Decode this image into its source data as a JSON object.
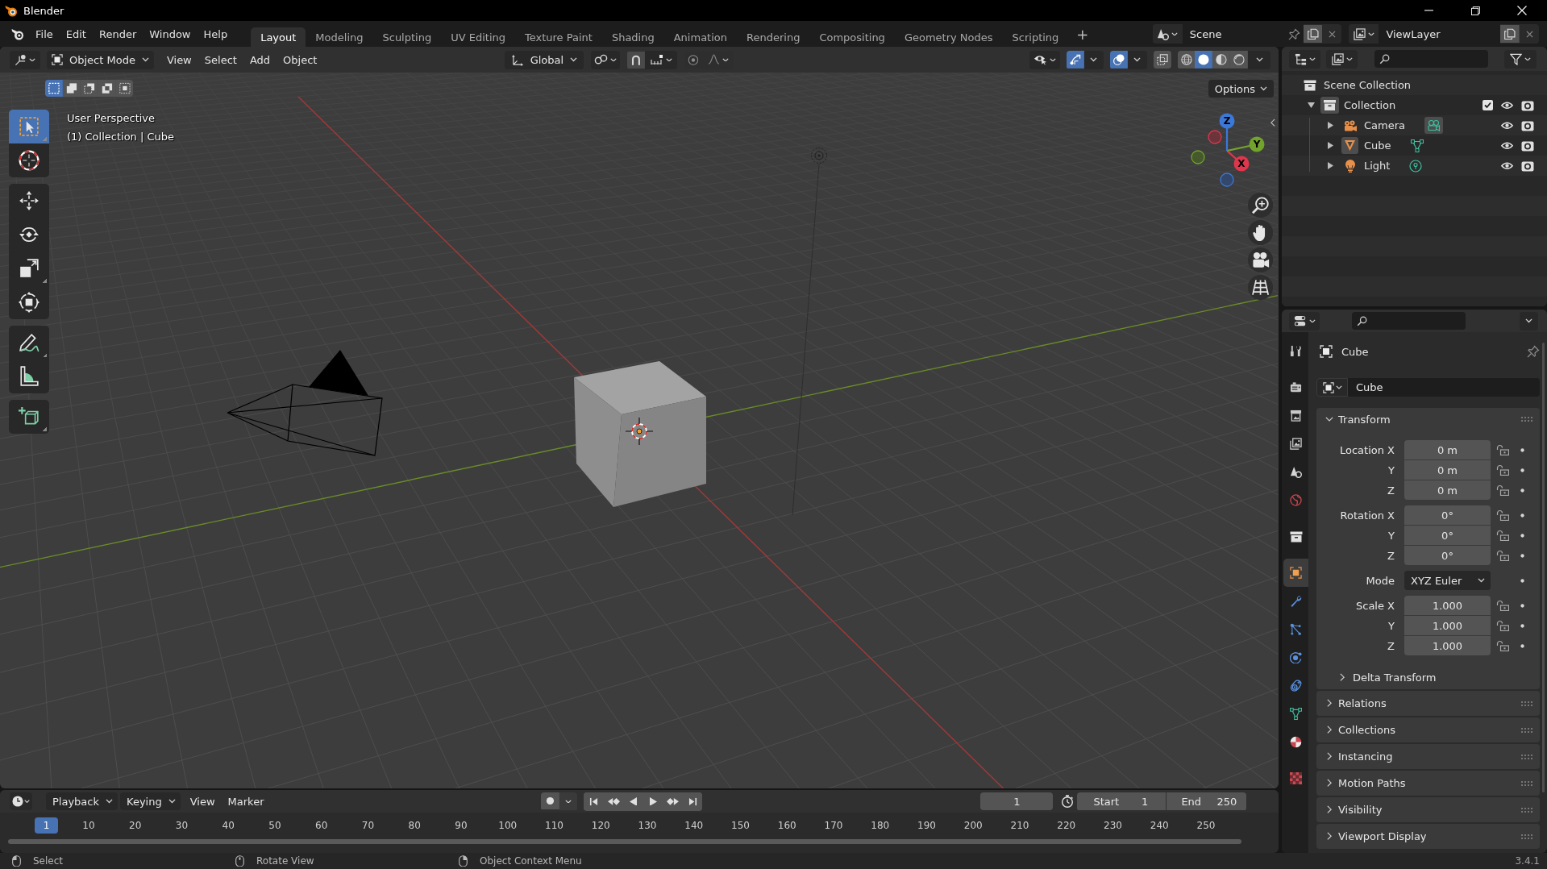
{
  "window": {
    "title": "Blender"
  },
  "top_bar": {
    "menus": [
      "File",
      "Edit",
      "Render",
      "Window",
      "Help"
    ],
    "workspaces": [
      {
        "label": "Layout",
        "selected": true
      },
      {
        "label": "Modeling",
        "selected": false
      },
      {
        "label": "Sculpting",
        "selected": false
      },
      {
        "label": "UV Editing",
        "selected": false
      },
      {
        "label": "Texture Paint",
        "selected": false
      },
      {
        "label": "Shading",
        "selected": false
      },
      {
        "label": "Animation",
        "selected": false
      },
      {
        "label": "Rendering",
        "selected": false
      },
      {
        "label": "Compositing",
        "selected": false
      },
      {
        "label": "Geometry Nodes",
        "selected": false
      },
      {
        "label": "Scripting",
        "selected": false
      }
    ],
    "add_workspace": "+",
    "scene": "Scene",
    "view_layer": "ViewLayer"
  },
  "viewport": {
    "header": {
      "mode": "Object Mode",
      "menus": [
        "View",
        "Select",
        "Add",
        "Object"
      ],
      "orientation": "Global",
      "snap": false,
      "proportional_editing": false,
      "gizmos": true,
      "overlays": true,
      "xray": false,
      "shading": [
        {
          "kind": "wireframe",
          "selected": false
        },
        {
          "kind": "solid",
          "selected": true
        },
        {
          "kind": "material",
          "selected": false
        },
        {
          "kind": "rendered",
          "selected": false
        }
      ]
    },
    "select_modes": [
      {
        "kind": "set",
        "selected": true
      },
      {
        "kind": "extend",
        "selected": false
      },
      {
        "kind": "subtract",
        "selected": false
      },
      {
        "kind": "invert",
        "selected": false
      },
      {
        "kind": "intersect",
        "selected": false
      }
    ],
    "options": "Options",
    "info": [
      "User Perspective",
      "(1) Collection | Cube"
    ],
    "tool_groups": [
      [
        {
          "kind": "select_box",
          "selected": true
        },
        {
          "kind": "cursor",
          "selected": false
        }
      ],
      [
        {
          "kind": "move",
          "selected": false
        },
        {
          "kind": "rotate",
          "selected": false
        },
        {
          "kind": "scale",
          "selected": false
        },
        {
          "kind": "transform",
          "selected": false
        }
      ],
      [
        {
          "kind": "annotate",
          "selected": false
        },
        {
          "kind": "measure",
          "selected": false
        }
      ],
      [
        {
          "kind": "add_cube",
          "selected": false
        }
      ]
    ],
    "gizmo_axes": [
      {
        "kind": "x",
        "label": "X"
      },
      {
        "kind": "y",
        "label": "Y"
      },
      {
        "kind": "z",
        "label": "Z"
      }
    ]
  },
  "outliner": {
    "tree": [
      {
        "label": "Scene Collection",
        "kind": "scene_collection",
        "children": [
          {
            "label": "Collection",
            "kind": "collection",
            "expanded": true,
            "active": true,
            "included": true,
            "visible": true,
            "renderable": true,
            "children": [
              {
                "label": "Camera",
                "kind": "camera",
                "expanded": false,
                "active": false,
                "data_active": true,
                "visible": true,
                "renderable": true
              },
              {
                "label": "Cube",
                "kind": "mesh",
                "expanded": false,
                "active": true,
                "data_active": false,
                "visible": true,
                "renderable": true
              },
              {
                "label": "Light",
                "kind": "light",
                "expanded": false,
                "active": false,
                "data_active": false,
                "visible": true,
                "renderable": true
              }
            ]
          }
        ]
      }
    ]
  },
  "properties": {
    "tab_groups": [
      [
        {
          "kind": "tool",
          "selected": false
        }
      ],
      [
        {
          "kind": "render",
          "selected": false
        },
        {
          "kind": "output",
          "selected": false
        },
        {
          "kind": "view_layer",
          "selected": false
        },
        {
          "kind": "scene",
          "selected": false
        },
        {
          "kind": "world",
          "selected": false
        }
      ],
      [
        {
          "kind": "collection",
          "selected": false
        }
      ],
      [
        {
          "kind": "object",
          "selected": true
        },
        {
          "kind": "modifiers",
          "selected": false
        },
        {
          "kind": "particles",
          "selected": false
        },
        {
          "kind": "physics",
          "selected": false
        },
        {
          "kind": "constraints",
          "selected": false
        },
        {
          "kind": "data",
          "selected": false
        },
        {
          "kind": "material",
          "selected": false
        }
      ],
      [
        {
          "kind": "texture",
          "selected": false
        }
      ]
    ],
    "context": "Cube",
    "object_name": "Cube",
    "panels": [
      {
        "title": "Transform",
        "expanded": true,
        "groups": [
          [
            {
              "label": "Location X",
              "value": "0 m",
              "kind": "number",
              "locked": false
            },
            {
              "label": "Y",
              "value": "0 m",
              "kind": "number",
              "locked": false
            },
            {
              "label": "Z",
              "value": "0 m",
              "kind": "number",
              "locked": false
            }
          ],
          [
            {
              "label": "Rotation X",
              "value": "0°",
              "kind": "number",
              "locked": false
            },
            {
              "label": "Y",
              "value": "0°",
              "kind": "number",
              "locked": false
            },
            {
              "label": "Z",
              "value": "0°",
              "kind": "number",
              "locked": false
            }
          ],
          [
            {
              "label": "Mode",
              "value": "XYZ Euler",
              "kind": "dropdown"
            }
          ],
          [
            {
              "label": "Scale X",
              "value": "1.000",
              "kind": "number",
              "locked": false
            },
            {
              "label": "Y",
              "value": "1.000",
              "kind": "number",
              "locked": false
            },
            {
              "label": "Z",
              "value": "1.000",
              "kind": "number",
              "locked": false
            }
          ]
        ],
        "subpanels": [
          {
            "title": "Delta Transform",
            "expanded": false
          }
        ]
      },
      {
        "title": "Relations",
        "expanded": false
      },
      {
        "title": "Collections",
        "expanded": false
      },
      {
        "title": "Instancing",
        "expanded": false
      },
      {
        "title": "Motion Paths",
        "expanded": false
      },
      {
        "title": "Visibility",
        "expanded": false
      },
      {
        "title": "Viewport Display",
        "expanded": false
      }
    ]
  },
  "timeline": {
    "menus": [
      {
        "label": "Playback",
        "kind": "dropdown"
      },
      {
        "label": "Keying",
        "kind": "dropdown"
      },
      {
        "label": "View",
        "kind": "menu"
      },
      {
        "label": "Marker",
        "kind": "menu"
      }
    ],
    "auto_keying": false,
    "current_frame": "1",
    "start": {
      "label": "Start",
      "value": "1"
    },
    "end": {
      "label": "End",
      "value": "250"
    },
    "ruler": [
      {
        "label": "1",
        "selected": true
      },
      {
        "label": "10",
        "selected": false
      },
      {
        "label": "20",
        "selected": false
      },
      {
        "label": "30",
        "selected": false
      },
      {
        "label": "40",
        "selected": false
      },
      {
        "label": "50",
        "selected": false
      },
      {
        "label": "60",
        "selected": false
      },
      {
        "label": "70",
        "selected": false
      },
      {
        "label": "80",
        "selected": false
      },
      {
        "label": "90",
        "selected": false
      },
      {
        "label": "100",
        "selected": false
      },
      {
        "label": "110",
        "selected": false
      },
      {
        "label": "120",
        "selected": false
      },
      {
        "label": "130",
        "selected": false
      },
      {
        "label": "140",
        "selected": false
      },
      {
        "label": "150",
        "selected": false
      },
      {
        "label": "160",
        "selected": false
      },
      {
        "label": "170",
        "selected": false
      },
      {
        "label": "180",
        "selected": false
      },
      {
        "label": "190",
        "selected": false
      },
      {
        "label": "200",
        "selected": false
      },
      {
        "label": "210",
        "selected": false
      },
      {
        "label": "220",
        "selected": false
      },
      {
        "label": "230",
        "selected": false
      },
      {
        "label": "240",
        "selected": false
      },
      {
        "label": "250",
        "selected": false
      }
    ]
  },
  "status_bar": {
    "hints": [
      {
        "kind": "left",
        "label": "Select"
      },
      {
        "kind": "middle",
        "label": "Rotate View"
      },
      {
        "kind": "right",
        "label": "Object Context Menu"
      }
    ],
    "version": "3.4.1"
  }
}
